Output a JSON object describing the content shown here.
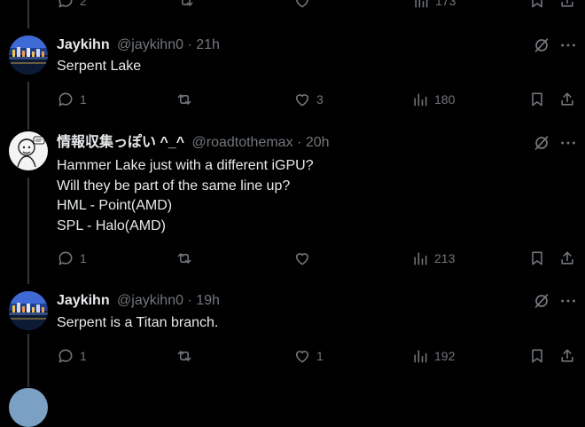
{
  "colors": {
    "background": "#000000",
    "text": "#e7e9ea",
    "muted": "#71767b",
    "thread_line": "#333639"
  },
  "top_stub": {
    "reply_count": "2",
    "views": "173"
  },
  "tweets": [
    {
      "name": "Jaykihn",
      "handle": "@jaykihn0",
      "time": "21h",
      "lines": [
        "Serpent Lake"
      ],
      "replies": "1",
      "reposts": "",
      "likes": "3",
      "views": "180",
      "avatar": "night-city-photo"
    },
    {
      "name": "情報収集っぽい ^_^",
      "handle": "@roadtothemax",
      "time": "20h",
      "lines": [
        "Hammer Lake just with a different iGPU?",
        "Will they be part of the same line up?",
        "HML - Point(AMD)",
        "SPL - Halo(AMD)"
      ],
      "replies": "1",
      "reposts": "",
      "likes": "",
      "views": "213",
      "avatar": "sketch-character"
    },
    {
      "name": "Jaykihn",
      "handle": "@jaykihn0",
      "time": "19h",
      "lines": [
        "Serpent is a Titan branch."
      ],
      "replies": "1",
      "reposts": "",
      "likes": "1",
      "views": "192",
      "avatar": "night-city-photo"
    }
  ],
  "icons": [
    "reply-icon",
    "repost-icon",
    "like-icon",
    "views-icon",
    "bookmark-icon",
    "share-icon",
    "grok-icon",
    "more-icon"
  ]
}
